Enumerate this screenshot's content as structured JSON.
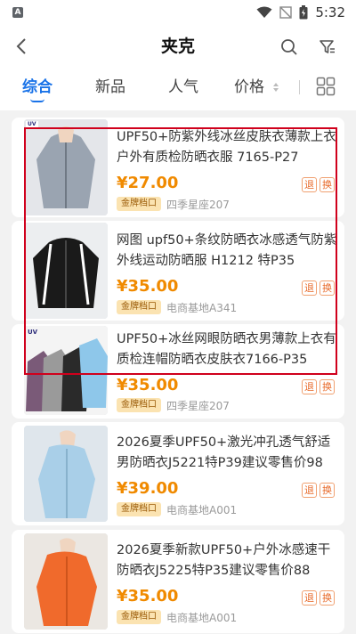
{
  "status_bar": {
    "app_icon_letter": "A",
    "time": "5:32"
  },
  "header": {
    "title": "夹克"
  },
  "tabs": [
    {
      "label": "综合",
      "active": true
    },
    {
      "label": "新品",
      "active": false
    },
    {
      "label": "人气",
      "active": false
    },
    {
      "label": "价格",
      "active": false
    }
  ],
  "products": [
    {
      "title": "UPF50+防紫外线冰丝皮肤衣薄款上衣户外有质检防晒衣服 7165-P27",
      "price": "¥27.00",
      "badge": "金牌档口",
      "shop": "四季星座207",
      "tag_return": "退",
      "tag_exchange": "换",
      "thumb_label": "UV"
    },
    {
      "title": "网图 upf50+条纹防晒衣冰感透气防紫外线运动防晒服 H1212 特P35",
      "price": "¥35.00",
      "badge": "金牌档口",
      "shop": "电商基地A341",
      "tag_return": "退",
      "tag_exchange": "换"
    },
    {
      "title": "UPF50+冰丝网眼防晒衣男薄款上衣有质检连帽防晒衣皮肤衣7166-P35",
      "price": "¥35.00",
      "badge": "金牌档口",
      "shop": "四季星座207",
      "tag_return": "退",
      "tag_exchange": "换",
      "thumb_label": "UV"
    },
    {
      "title": "2026夏季UPF50+激光冲孔透气舒适男防晒衣J5221特P39建议零售价98",
      "price": "¥39.00",
      "badge": "金牌档口",
      "shop": "电商基地A001",
      "tag_return": "退",
      "tag_exchange": "换"
    },
    {
      "title": "2026夏季新款UPF50+户外冰感速干防晒衣J5225特P35建议零售价88",
      "price": "¥35.00",
      "badge": "金牌档口",
      "shop": "电商基地A001",
      "tag_return": "退",
      "tag_exchange": "换"
    }
  ],
  "colors": {
    "accent": "#1a73e8",
    "price": "#f08a00",
    "highlight": "#d0001c"
  }
}
